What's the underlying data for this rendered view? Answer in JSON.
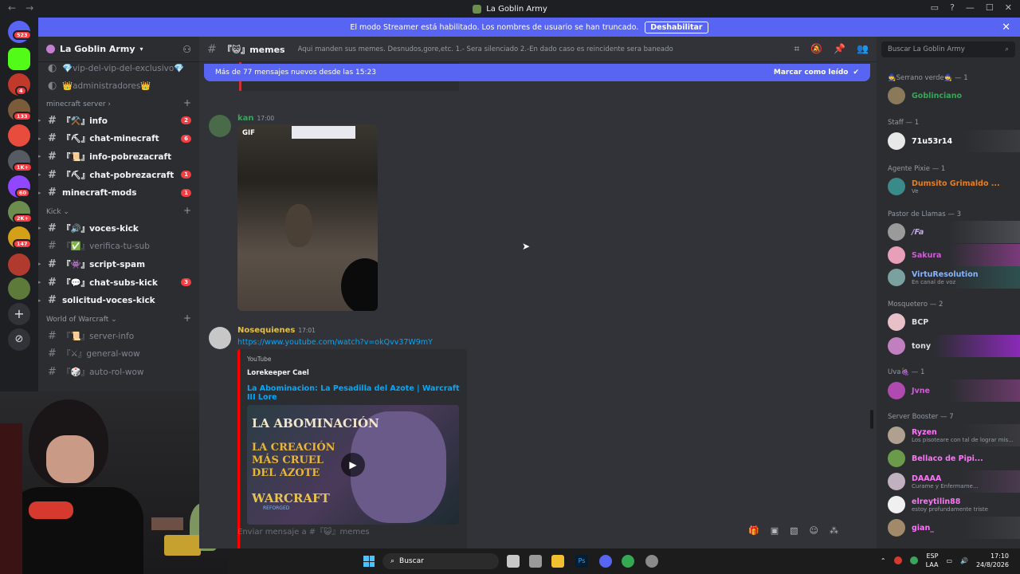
{
  "window": {
    "title": "La Goblin Army"
  },
  "banner": {
    "text": "El modo Streamer está habilitado. Los nombres de usuario se han truncado.",
    "button": "Deshabilitar"
  },
  "guild_badges": [
    "523",
    "4",
    "133",
    "1K+",
    "60",
    "2K+",
    "147"
  ],
  "server": {
    "name": "La Goblin Army"
  },
  "sidebar": {
    "top": [
      {
        "name": "💎vip-del-vip-del-exclusivo💎"
      },
      {
        "name": "👑administradores👑"
      }
    ],
    "categories": [
      {
        "name": "minecraft server",
        "channels": [
          {
            "name": "『⚒️』info",
            "badge": "2"
          },
          {
            "name": "『⛏』chat-minecraft",
            "badge": "6"
          },
          {
            "name": "『📜』info-pobrezacraft",
            "badge": ""
          },
          {
            "name": "『⛏』chat-pobrezacraft",
            "badge": "1"
          },
          {
            "name": "minecraft-mods",
            "badge": "1"
          }
        ]
      },
      {
        "name": "Kick",
        "channels": [
          {
            "name": "『🔊』voces-kick",
            "badge": ""
          },
          {
            "name": "『✅』verifica-tu-sub",
            "badge": ""
          },
          {
            "name": "『👾』script-spam",
            "badge": ""
          },
          {
            "name": "『💬』chat-subs-kick",
            "badge": "3"
          },
          {
            "name": "solicitud-voces-kick",
            "badge": ""
          }
        ]
      },
      {
        "name": "World of Warcraft",
        "channels": [
          {
            "name": "『📜』server-info",
            "badge": ""
          },
          {
            "name": "『⚔』general-wow",
            "badge": ""
          },
          {
            "name": "『🎲』auto-rol-wow",
            "badge": ""
          }
        ]
      }
    ]
  },
  "channel_header": {
    "name": "『😺』memes",
    "topic": "Aqui manden sus memes. Desnudos,gore,etc. 1.- Sera silenciado 2.-En dado caso es reincidente sera baneado"
  },
  "new_messages": {
    "text": "Más de 77 mensajes nuevos desde las 15:23",
    "action": "Marcar como leído"
  },
  "messages": [
    {
      "author": "kan",
      "time": "17:00",
      "attachment": "GIF"
    },
    {
      "author": "Nosequienes",
      "time": "17:01",
      "link": "https://www.youtube.com/watch?v=okQvv37W9mY",
      "embed": {
        "provider": "YouTube",
        "author": "Lorekeeper Cael",
        "title": "La Abominacion: La Pesadilla del Azote | Warcraft III Lore",
        "thumb_lines": [
          "LA ABOMINACIÓN",
          "LA CREACIÓN",
          "MÁS CRUEL",
          "DEL AZOTE",
          "WARCRAFT",
          "REFORGED"
        ]
      }
    }
  ],
  "composer": {
    "placeholder": "Enviar mensaje a #『😺』memes"
  },
  "members": {
    "search": "Buscar La Goblin Army",
    "groups": [
      {
        "role": "🧙Serrano verde🧙 — 1",
        "members": [
          {
            "name": "Goblinciano",
            "status": "",
            "color": "#3ba55c"
          }
        ]
      },
      {
        "role": "Staff — 1",
        "members": [
          {
            "name": "71u53r14",
            "status": "",
            "color": "#ffffff"
          }
        ]
      },
      {
        "role": "Agente Pixie — 1",
        "members": [
          {
            "name": "Dumsito Grimaldo ...",
            "status": "Ve",
            "color": "#e67e22"
          }
        ]
      },
      {
        "role": "Pastor de Llamas — 3",
        "members": [
          {
            "name": "/Fa",
            "status": "",
            "color": "#c9a7e8"
          },
          {
            "name": "Sakura",
            "status": "",
            "color": "#d15bd8"
          },
          {
            "name": "VirtuResolution",
            "status": "En canal de voz",
            "color": "#8ab4f8"
          }
        ]
      },
      {
        "role": "Mosquetero — 2",
        "members": [
          {
            "name": "BCP",
            "status": "",
            "color": "#dbdee1"
          },
          {
            "name": "tony",
            "status": "",
            "color": "#dbdee1"
          }
        ]
      },
      {
        "role": "Uva🍇 — 1",
        "members": [
          {
            "name": "Jvne",
            "status": "",
            "color": "#d15bd8"
          }
        ]
      },
      {
        "role": "Server Booster — 7",
        "members": [
          {
            "name": "Ryzen",
            "status": "Los pisoteare con tal de lograr mis...",
            "color": "#ff73fa"
          },
          {
            "name": "Bellaco de Pipi...",
            "status": "",
            "color": "#ff73fa"
          },
          {
            "name": "DAAAA",
            "status": "Curame y Enfermame...",
            "color": "#ff73fa"
          },
          {
            "name": "elreytilin88",
            "status": "estoy profundamente triste",
            "color": "#ff73fa"
          },
          {
            "name": "gian_",
            "status": "",
            "color": "#ff73fa"
          }
        ]
      }
    ]
  },
  "taskbar": {
    "search": "Buscar",
    "lang": "ESP",
    "layout": "LAA",
    "time": "17:10",
    "date": "24/8/2026"
  }
}
